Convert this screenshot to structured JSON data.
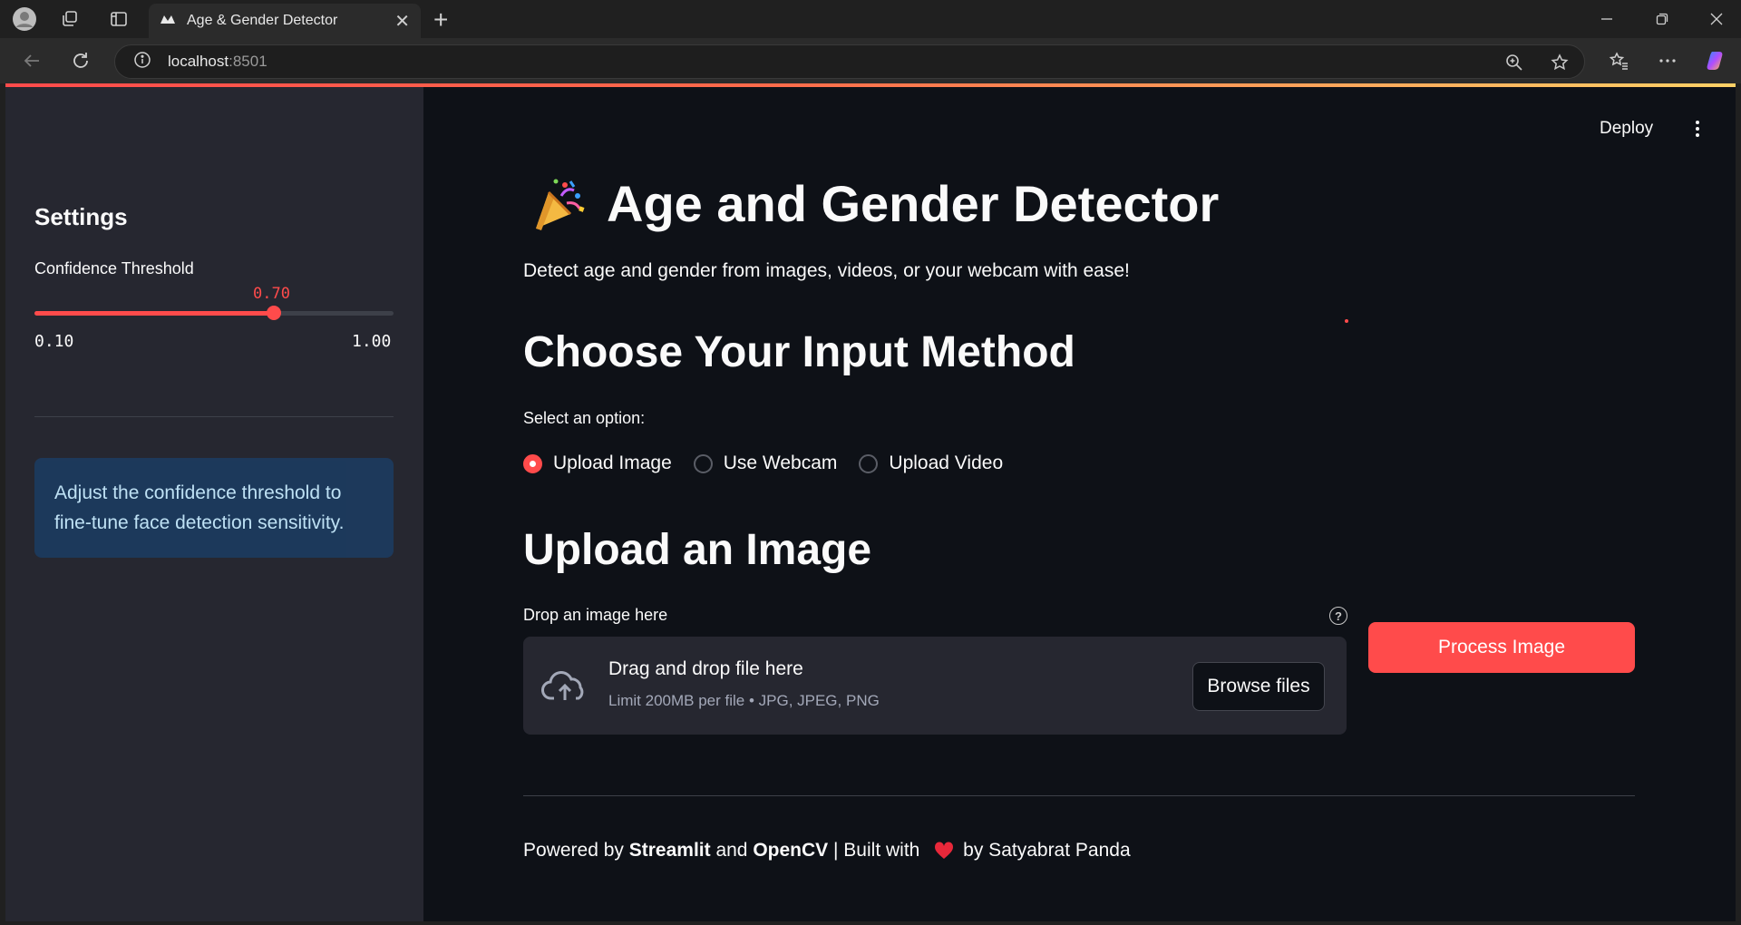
{
  "browser": {
    "tab_title": "Age & Gender Detector",
    "url_host": "localhost",
    "url_port": ":8501"
  },
  "sidebar": {
    "title": "Settings",
    "slider": {
      "label": "Confidence Threshold",
      "value": 0.7,
      "value_text": "0.70",
      "min": 0.1,
      "min_text": "0.10",
      "max": 1.0,
      "max_text": "1.00"
    },
    "info": "Adjust the confidence threshold to fine-tune face detection sensitivity."
  },
  "header": {
    "deploy_label": "Deploy"
  },
  "main": {
    "title": "Age and Gender Detector",
    "title_emoji": "party-popper",
    "subtitle": "Detect age and gender from images, videos, or your webcam with ease!",
    "input_heading": "Choose Your Input Method",
    "radio_label": "Select an option:",
    "radio_options": [
      {
        "label": "Upload Image",
        "selected": true
      },
      {
        "label": "Use Webcam",
        "selected": false
      },
      {
        "label": "Upload Video",
        "selected": false
      }
    ],
    "upload_heading": "Upload an Image",
    "uploader": {
      "label": "Drop an image here",
      "title": "Drag and drop file here",
      "limit": "Limit 200MB per file • JPG, JPEG, PNG",
      "browse_label": "Browse files"
    },
    "process_label": "Process Image"
  },
  "footer": {
    "prefix": "Powered by ",
    "streamlit": "Streamlit",
    "and": " and ",
    "opencv": "OpenCV",
    "built": " | Built with ",
    "by": "by Satyabrat Panda"
  },
  "colors": {
    "accent": "#ff4b4b",
    "background": "#0e1117",
    "sidebar": "#262730",
    "info_bg": "#1c3a5e",
    "info_text": "#c7ebff"
  }
}
